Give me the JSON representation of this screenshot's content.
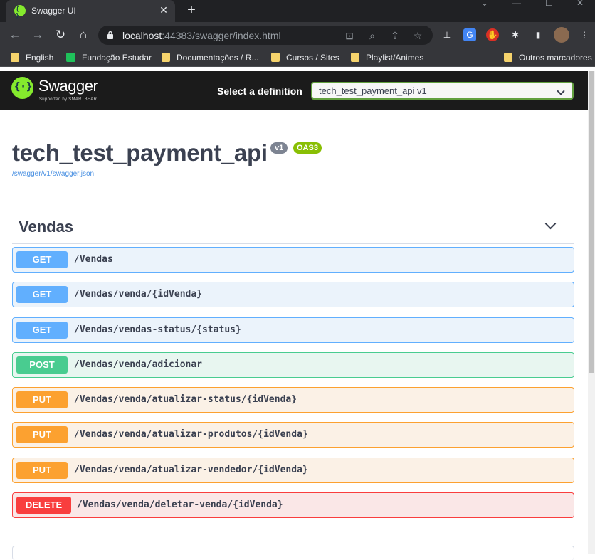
{
  "browser": {
    "tab_title": "Swagger UI",
    "url_host": "localhost",
    "url_rest": ":44383/swagger/index.html",
    "bookmarks": [
      "English",
      "Fundação Estudar",
      "Documentações / R...",
      "Cursos / Sites",
      "Playlist/Animes",
      "Outros marcadores"
    ]
  },
  "swagger": {
    "logo_text": "Swagger",
    "logo_sub": "Supported by SMARTBEAR",
    "definition_label": "Select a definition",
    "definition_value": "tech_test_payment_api v1",
    "api_title": "tech_test_payment_api",
    "version_badge": "v1",
    "oas_badge": "OAS3",
    "spec_url": "/swagger/v1/swagger.json",
    "tag": "Vendas",
    "operations": [
      {
        "method": "GET",
        "path": "/Vendas"
      },
      {
        "method": "GET",
        "path": "/Vendas/venda/{idVenda}"
      },
      {
        "method": "GET",
        "path": "/Vendas/vendas-status/{status}"
      },
      {
        "method": "POST",
        "path": "/Vendas/venda/adicionar"
      },
      {
        "method": "PUT",
        "path": "/Vendas/venda/atualizar-status/{idVenda}"
      },
      {
        "method": "PUT",
        "path": "/Vendas/venda/atualizar-produtos/{idVenda}"
      },
      {
        "method": "PUT",
        "path": "/Vendas/venda/atualizar-vendedor/{idVenda}"
      },
      {
        "method": "DELETE",
        "path": "/Vendas/venda/deletar-venda/{idVenda}"
      }
    ]
  }
}
